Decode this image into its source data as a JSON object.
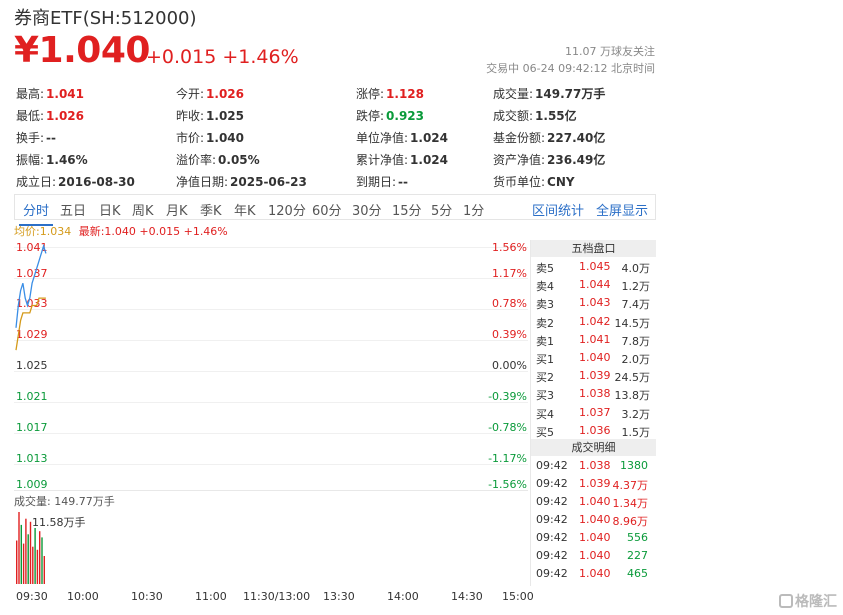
{
  "header": {
    "title": "券商ETF(SH:512000)",
    "price": "¥1.040",
    "change": "+0.015 +1.46%",
    "followers": "11.07 万球友关注",
    "status": "交易中 06-24 09:42:12 北京时间"
  },
  "info": {
    "high": {
      "label": "最高:",
      "value": "1.041"
    },
    "low": {
      "label": "最低:",
      "value": "1.026"
    },
    "turnover": {
      "label": "换手:",
      "value": "--"
    },
    "amplitude": {
      "label": "振幅:",
      "value": "1.46%"
    },
    "established": {
      "label": "成立日:",
      "value": "2016-08-30"
    },
    "open": {
      "label": "今开:",
      "value": "1.026"
    },
    "prev_close": {
      "label": "昨收:",
      "value": "1.025"
    },
    "market_price": {
      "label": "市价:",
      "value": "1.040"
    },
    "premium": {
      "label": "溢价率:",
      "value": "0.05%"
    },
    "nav_date": {
      "label": "净值日期:",
      "value": "2025-06-23"
    },
    "limit_up": {
      "label": "涨停:",
      "value": "1.128"
    },
    "limit_down": {
      "label": "跌停:",
      "value": "0.923"
    },
    "unit_nav": {
      "label": "单位净值:",
      "value": "1.024"
    },
    "cum_nav": {
      "label": "累计净值:",
      "value": "1.024"
    },
    "expiry": {
      "label": "到期日:",
      "value": "--"
    },
    "volume": {
      "label": "成交量:",
      "value": "149.77万手"
    },
    "amount": {
      "label": "成交额:",
      "value": "1.55亿"
    },
    "fund_share": {
      "label": "基金份额:",
      "value": "227.40亿"
    },
    "net_assets": {
      "label": "资产净值:",
      "value": "236.49亿"
    },
    "currency": {
      "label": "货币单位:",
      "value": "CNY"
    }
  },
  "tabs": [
    "分时",
    "五日",
    "日K",
    "周K",
    "月K",
    "季K",
    "年K",
    "120分",
    "60分",
    "30分",
    "15分",
    "5分",
    "1分"
  ],
  "tab_actions": {
    "interval_stats": "区间统计",
    "fullscreen": "全屏显示"
  },
  "legend": {
    "avg": "均价:1.034",
    "latest": "最新:1.040 +0.015 +1.46%"
  },
  "y_left": [
    "1.041",
    "1.037",
    "1.033",
    "1.029",
    "1.025",
    "1.021",
    "1.017",
    "1.013",
    "1.009"
  ],
  "y_right": [
    "1.56%",
    "1.17%",
    "0.78%",
    "0.39%",
    "0.00%",
    "-0.39%",
    "-0.78%",
    "-1.17%",
    "-1.56%"
  ],
  "volume_panel": {
    "label": "成交量: 149.77万手",
    "max": "11.58万手"
  },
  "x_axis": [
    "09:30",
    "10:00",
    "10:30",
    "11:00",
    "11:30/13:00",
    "13:30",
    "14:00",
    "14:30",
    "15:00"
  ],
  "order_book": {
    "header": "五档盘口",
    "rows": [
      {
        "label": "卖5",
        "price": "1.045",
        "vol": "4.0万"
      },
      {
        "label": "卖4",
        "price": "1.044",
        "vol": "1.2万"
      },
      {
        "label": "卖3",
        "price": "1.043",
        "vol": "7.4万"
      },
      {
        "label": "卖2",
        "price": "1.042",
        "vol": "14.5万"
      },
      {
        "label": "卖1",
        "price": "1.041",
        "vol": "7.8万"
      },
      {
        "label": "买1",
        "price": "1.040",
        "vol": "2.0万"
      },
      {
        "label": "买2",
        "price": "1.039",
        "vol": "24.5万"
      },
      {
        "label": "买3",
        "price": "1.038",
        "vol": "13.8万"
      },
      {
        "label": "买4",
        "price": "1.037",
        "vol": "3.2万"
      },
      {
        "label": "买5",
        "price": "1.036",
        "vol": "1.5万"
      }
    ]
  },
  "trades": {
    "header": "成交明细",
    "rows": [
      {
        "time": "09:42",
        "price": "1.038",
        "vol": "1380",
        "dir": "buy"
      },
      {
        "time": "09:42",
        "price": "1.039",
        "vol": "4.37万",
        "dir": "sell"
      },
      {
        "time": "09:42",
        "price": "1.040",
        "vol": "1.34万",
        "dir": "sell"
      },
      {
        "time": "09:42",
        "price": "1.040",
        "vol": "8.96万",
        "dir": "sell"
      },
      {
        "time": "09:42",
        "price": "1.040",
        "vol": "556",
        "dir": "buy"
      },
      {
        "time": "09:42",
        "price": "1.040",
        "vol": "227",
        "dir": "buy"
      },
      {
        "time": "09:42",
        "price": "1.040",
        "vol": "465",
        "dir": "buy"
      }
    ]
  },
  "chart_data": {
    "type": "line",
    "y_range": [
      1.009,
      1.041
    ],
    "prev_close": 1.025,
    "series": [
      {
        "name": "最新",
        "color": "#3a8ee6",
        "values": [
          1.03,
          1.033,
          1.035,
          1.036,
          1.034,
          1.033,
          1.034,
          1.036,
          1.037,
          1.038,
          1.039,
          1.04,
          1.041,
          1.04
        ]
      },
      {
        "name": "均价",
        "color": "#d49a1a",
        "values": [
          1.027,
          1.029,
          1.031,
          1.032,
          1.032,
          1.032,
          1.032,
          1.033,
          1.033,
          1.033,
          1.034,
          1.034,
          1.034,
          1.034
        ]
      }
    ],
    "volume": [
      7.0,
      11.58,
      9.5,
      6.5,
      10.5,
      8.0,
      10.0,
      6.0,
      9.0,
      5.5,
      8.5,
      7.5,
      4.5
    ],
    "volume_max": 11.58
  },
  "watermark": "格隆汇"
}
